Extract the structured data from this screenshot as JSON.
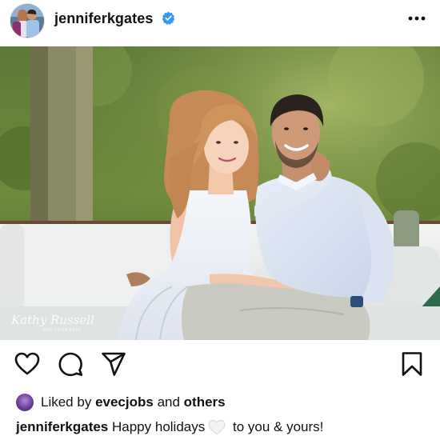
{
  "post": {
    "username": "jenniferkgates",
    "verified": true,
    "more_icon": "more-horizontal-icon"
  },
  "photo": {
    "watermark_name": "Kathy Russell",
    "watermark_sub": "PHOTOGRAPHY"
  },
  "actions": {
    "like_icon": "heart-outline-icon",
    "comment_icon": "comment-bubble-icon",
    "share_icon": "paper-plane-icon",
    "save_icon": "bookmark-outline-icon"
  },
  "likes": {
    "prefix": "Liked by",
    "user": "evecjobs",
    "joiner": "and",
    "others": "others"
  },
  "caption": {
    "username": "jenniferkgates",
    "text_before": "Happy holidays",
    "emoji": "white-heart-emoji",
    "text_after": "to you & yours!"
  },
  "colors": {
    "verified_badge": "#3897f0",
    "text": "#111111"
  }
}
